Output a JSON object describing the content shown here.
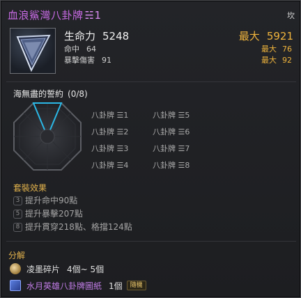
{
  "item": {
    "name": "血浪鯊灣八卦牌",
    "grade_mark": "☵1",
    "element_tag": "坎",
    "main_stat": {
      "label": "生命力",
      "value": "5248",
      "max_label": "最大",
      "max_value": "5921"
    },
    "sub_stats": [
      {
        "label": "命中",
        "value": "64",
        "max_label": "最大",
        "max_value": "76"
      },
      {
        "label": "暴擊傷害",
        "value": "91",
        "max_label": "最大",
        "max_value": "92"
      }
    ]
  },
  "set": {
    "title": "海無盡的誓約",
    "count": "(0/8)",
    "pieces": [
      "八卦牌 ☰1",
      "八卦牌 ☰2",
      "八卦牌 ☰3",
      "八卦牌 ☰4",
      "八卦牌 ☰5",
      "八卦牌 ☰6",
      "八卦牌 ☰7",
      "八卦牌 ☰8"
    ]
  },
  "bonus": {
    "title": "套裝效果",
    "rows": [
      {
        "num": "3",
        "text": "提升命中90點"
      },
      {
        "num": "5",
        "text": "提升暴擊207點"
      },
      {
        "num": "8",
        "text": "提升貫穿218點、格擋124點"
      }
    ]
  },
  "decompose": {
    "title": "分解",
    "materials": [
      {
        "icon": "shard-icon",
        "name": "凌墨碎片",
        "qty": "4個~ 5個",
        "badge": ""
      },
      {
        "icon": "blueprint-icon",
        "name": "水月英雄八卦牌圖紙",
        "qty": "1個",
        "badge": "隨機"
      }
    ]
  },
  "colors": {
    "item_name": "#c96be6",
    "max_value": "#f0b43c",
    "section_header": "#e2b24c",
    "active_slot": "#2bb8e6"
  }
}
